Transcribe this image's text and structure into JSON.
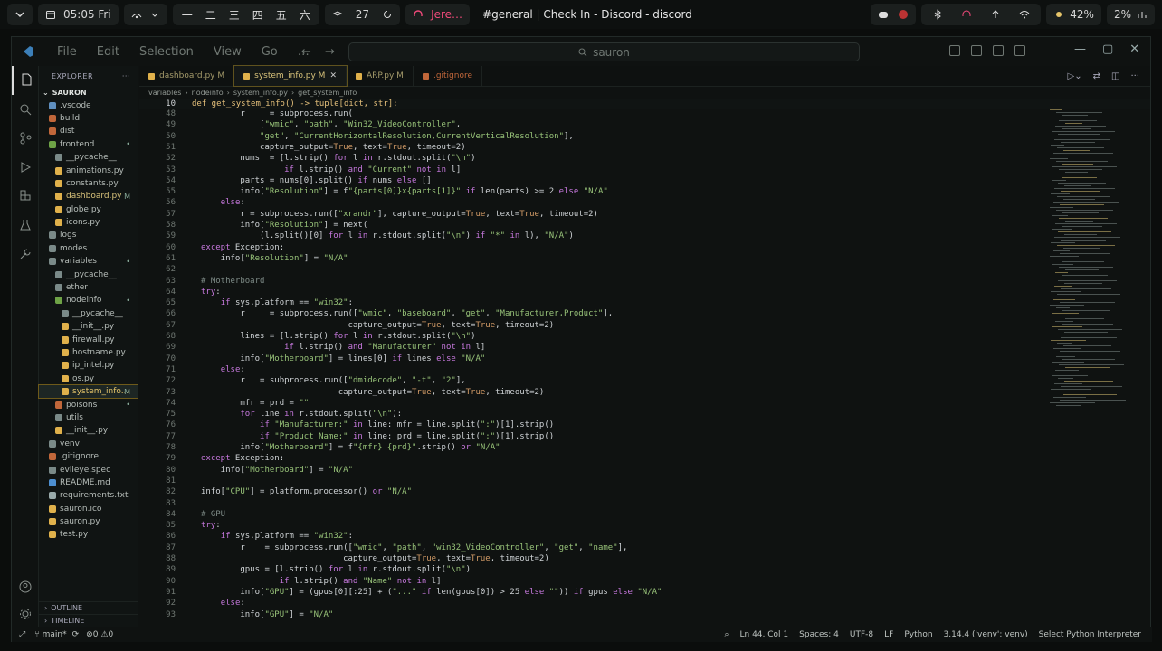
{
  "topbar": {
    "time": "05:05 Fri",
    "workspaces": [
      "一",
      "二",
      "三",
      "四",
      "五",
      "六"
    ],
    "workspace_count": "27",
    "discord_user": "Jere…",
    "window_title": "#general | Check In - Discord - discord",
    "battery": "42%",
    "cpu": "2%"
  },
  "menu": [
    "File",
    "Edit",
    "Selection",
    "View",
    "Go",
    "…"
  ],
  "command_center": "sauron",
  "explorer": {
    "title": "EXPLORER",
    "root": "SAURON",
    "items": [
      {
        "label": ".vscode",
        "indent": 1,
        "color": "#5f8fbf"
      },
      {
        "label": "build",
        "indent": 1,
        "color": "#c1673a"
      },
      {
        "label": "dist",
        "indent": 1,
        "color": "#c1673a"
      },
      {
        "label": "frontend",
        "indent": 1,
        "color": "#6ea346",
        "badge": "•"
      },
      {
        "label": "__pycache__",
        "indent": 2,
        "color": "#7a8a88"
      },
      {
        "label": "animations.py",
        "indent": 2,
        "color": "#e0b14b"
      },
      {
        "label": "constants.py",
        "indent": 2,
        "color": "#e0b14b"
      },
      {
        "label": "dashboard.py",
        "indent": 2,
        "color": "#e0b14b",
        "badge": "M",
        "mod": true
      },
      {
        "label": "globe.py",
        "indent": 2,
        "color": "#e0b14b"
      },
      {
        "label": "icons.py",
        "indent": 2,
        "color": "#e0b14b"
      },
      {
        "label": "logs",
        "indent": 1,
        "color": "#7a8a88"
      },
      {
        "label": "modes",
        "indent": 1,
        "color": "#7a8a88"
      },
      {
        "label": "variables",
        "indent": 1,
        "color": "#7a8a88",
        "badge": "•"
      },
      {
        "label": "__pycache__",
        "indent": 2,
        "color": "#7a8a88"
      },
      {
        "label": "ether",
        "indent": 2,
        "color": "#7a8a88"
      },
      {
        "label": "nodeinfo",
        "indent": 2,
        "color": "#6ea346",
        "badge": "•"
      },
      {
        "label": "__pycache__",
        "indent": 3,
        "color": "#7a8a88"
      },
      {
        "label": "__init__.py",
        "indent": 3,
        "color": "#e0b14b"
      },
      {
        "label": "firewall.py",
        "indent": 3,
        "color": "#e0b14b"
      },
      {
        "label": "hostname.py",
        "indent": 3,
        "color": "#e0b14b"
      },
      {
        "label": "ip_intel.py",
        "indent": 3,
        "color": "#e0b14b"
      },
      {
        "label": "os.py",
        "indent": 3,
        "color": "#e0b14b"
      },
      {
        "label": "system_info...",
        "indent": 3,
        "color": "#e0b14b",
        "badge": "M",
        "selected": true
      },
      {
        "label": "poisons",
        "indent": 2,
        "color": "#c1673a",
        "badge": "•"
      },
      {
        "label": "utils",
        "indent": 2,
        "color": "#7a8a88"
      },
      {
        "label": "__init__.py",
        "indent": 2,
        "color": "#e0b14b"
      },
      {
        "label": "venv",
        "indent": 1,
        "color": "#7a8a88"
      },
      {
        "label": ".gitignore",
        "indent": 1,
        "color": "#c1673a"
      },
      {
        "label": "evileye.spec",
        "indent": 1,
        "color": "#7a8a88"
      },
      {
        "label": "README.md",
        "indent": 1,
        "color": "#4d8fd0"
      },
      {
        "label": "requirements.txt",
        "indent": 1,
        "color": "#9aa"
      },
      {
        "label": "sauron.ico",
        "indent": 1,
        "color": "#e0b14b"
      },
      {
        "label": "sauron.py",
        "indent": 1,
        "color": "#e0b14b"
      },
      {
        "label": "test.py",
        "indent": 1,
        "color": "#e0b14b"
      }
    ],
    "outline": "OUTLINE",
    "timeline": "TIMELINE"
  },
  "tabs": [
    {
      "label": "dashboard.py M",
      "active": false
    },
    {
      "label": "system_info.py M",
      "active": true
    },
    {
      "label": "ARP.py M",
      "active": false
    },
    {
      "label": ".gitignore",
      "active": false
    }
  ],
  "breadcrumb": [
    "variables",
    "nodeinfo",
    "system_info.py",
    "get_system_info"
  ],
  "sticky": {
    "line": "10",
    "code": "def get_system_info() -> tuple[dict, str]:"
  },
  "code_lines": [
    {
      "n": "48",
      "t": "        r     = subprocess.run("
    },
    {
      "n": "49",
      "t": "            [\"wmic\", \"path\", \"Win32_VideoController\","
    },
    {
      "n": "50",
      "t": "            \"get\", \"CurrentHorizontalResolution,CurrentVerticalResolution\"],"
    },
    {
      "n": "51",
      "t": "            capture_output=True, text=True, timeout=2)"
    },
    {
      "n": "52",
      "t": "        nums  = [l.strip() for l in r.stdout.split(\"\\n\")"
    },
    {
      "n": "53",
      "t": "                 if l.strip() and \"Current\" not in l]"
    },
    {
      "n": "54",
      "t": "        parts = nums[0].split() if nums else []"
    },
    {
      "n": "55",
      "t": "        info[\"Resolution\"] = f\"{parts[0]}x{parts[1]}\" if len(parts) >= 2 else \"N/A\""
    },
    {
      "n": "56",
      "t": "    else:"
    },
    {
      "n": "57",
      "t": "        r = subprocess.run([\"xrandr\"], capture_output=True, text=True, timeout=2)"
    },
    {
      "n": "58",
      "t": "        info[\"Resolution\"] = next("
    },
    {
      "n": "59",
      "t": "            (l.split()[0] for l in r.stdout.split(\"\\n\") if \"*\" in l), \"N/A\")"
    },
    {
      "n": "60",
      "t": "except Exception:"
    },
    {
      "n": "61",
      "t": "    info[\"Resolution\"] = \"N/A\""
    },
    {
      "n": "62",
      "t": ""
    },
    {
      "n": "63",
      "t": "# Motherboard"
    },
    {
      "n": "64",
      "t": "try:"
    },
    {
      "n": "65",
      "t": "    if sys.platform == \"win32\":"
    },
    {
      "n": "66",
      "t": "        r     = subprocess.run([\"wmic\", \"baseboard\", \"get\", \"Manufacturer,Product\"],"
    },
    {
      "n": "67",
      "t": "                              capture_output=True, text=True, timeout=2)"
    },
    {
      "n": "68",
      "t": "        lines = [l.strip() for l in r.stdout.split(\"\\n\")"
    },
    {
      "n": "69",
      "t": "                 if l.strip() and \"Manufacturer\" not in l]"
    },
    {
      "n": "70",
      "t": "        info[\"Motherboard\"] = lines[0] if lines else \"N/A\""
    },
    {
      "n": "71",
      "t": "    else:"
    },
    {
      "n": "72",
      "t": "        r   = subprocess.run([\"dmidecode\", \"-t\", \"2\"],"
    },
    {
      "n": "73",
      "t": "                            capture_output=True, text=True, timeout=2)"
    },
    {
      "n": "74",
      "t": "        mfr = prd = \"\""
    },
    {
      "n": "75",
      "t": "        for line in r.stdout.split(\"\\n\"):"
    },
    {
      "n": "76",
      "t": "            if \"Manufacturer:\" in line: mfr = line.split(\":\")[1].strip()"
    },
    {
      "n": "77",
      "t": "            if \"Product Name:\" in line: prd = line.split(\":\")[1].strip()"
    },
    {
      "n": "78",
      "t": "        info[\"Motherboard\"] = f\"{mfr} {prd}\".strip() or \"N/A\""
    },
    {
      "n": "79",
      "t": "except Exception:"
    },
    {
      "n": "80",
      "t": "    info[\"Motherboard\"] = \"N/A\""
    },
    {
      "n": "81",
      "t": ""
    },
    {
      "n": "82",
      "t": "info[\"CPU\"] = platform.processor() or \"N/A\""
    },
    {
      "n": "83",
      "t": ""
    },
    {
      "n": "84",
      "t": "# GPU"
    },
    {
      "n": "85",
      "t": "try:"
    },
    {
      "n": "86",
      "t": "    if sys.platform == \"win32\":"
    },
    {
      "n": "87",
      "t": "        r    = subprocess.run([\"wmic\", \"path\", \"win32_VideoController\", \"get\", \"name\"],"
    },
    {
      "n": "88",
      "t": "                             capture_output=True, text=True, timeout=2)"
    },
    {
      "n": "89",
      "t": "        gpus = [l.strip() for l in r.stdout.split(\"\\n\")"
    },
    {
      "n": "90",
      "t": "                if l.strip() and \"Name\" not in l]"
    },
    {
      "n": "91",
      "t": "        info[\"GPU\"] = (gpus[0][:25] + (\"...\" if len(gpus[0]) > 25 else \"\")) if gpus else \"N/A\""
    },
    {
      "n": "92",
      "t": "    else:"
    },
    {
      "n": "93",
      "t": "        info[\"GPU\"] = \"N/A\""
    }
  ],
  "status": {
    "branch": "main*",
    "problems": "0",
    "warnings": "0",
    "position": "Ln 44, Col 1",
    "spaces": "Spaces: 4",
    "encoding": "UTF-8",
    "eol": "LF",
    "language": "Python",
    "interpreter": "3.14.4 ('venv': venv)",
    "select_interpreter": "Select Python Interpreter"
  }
}
